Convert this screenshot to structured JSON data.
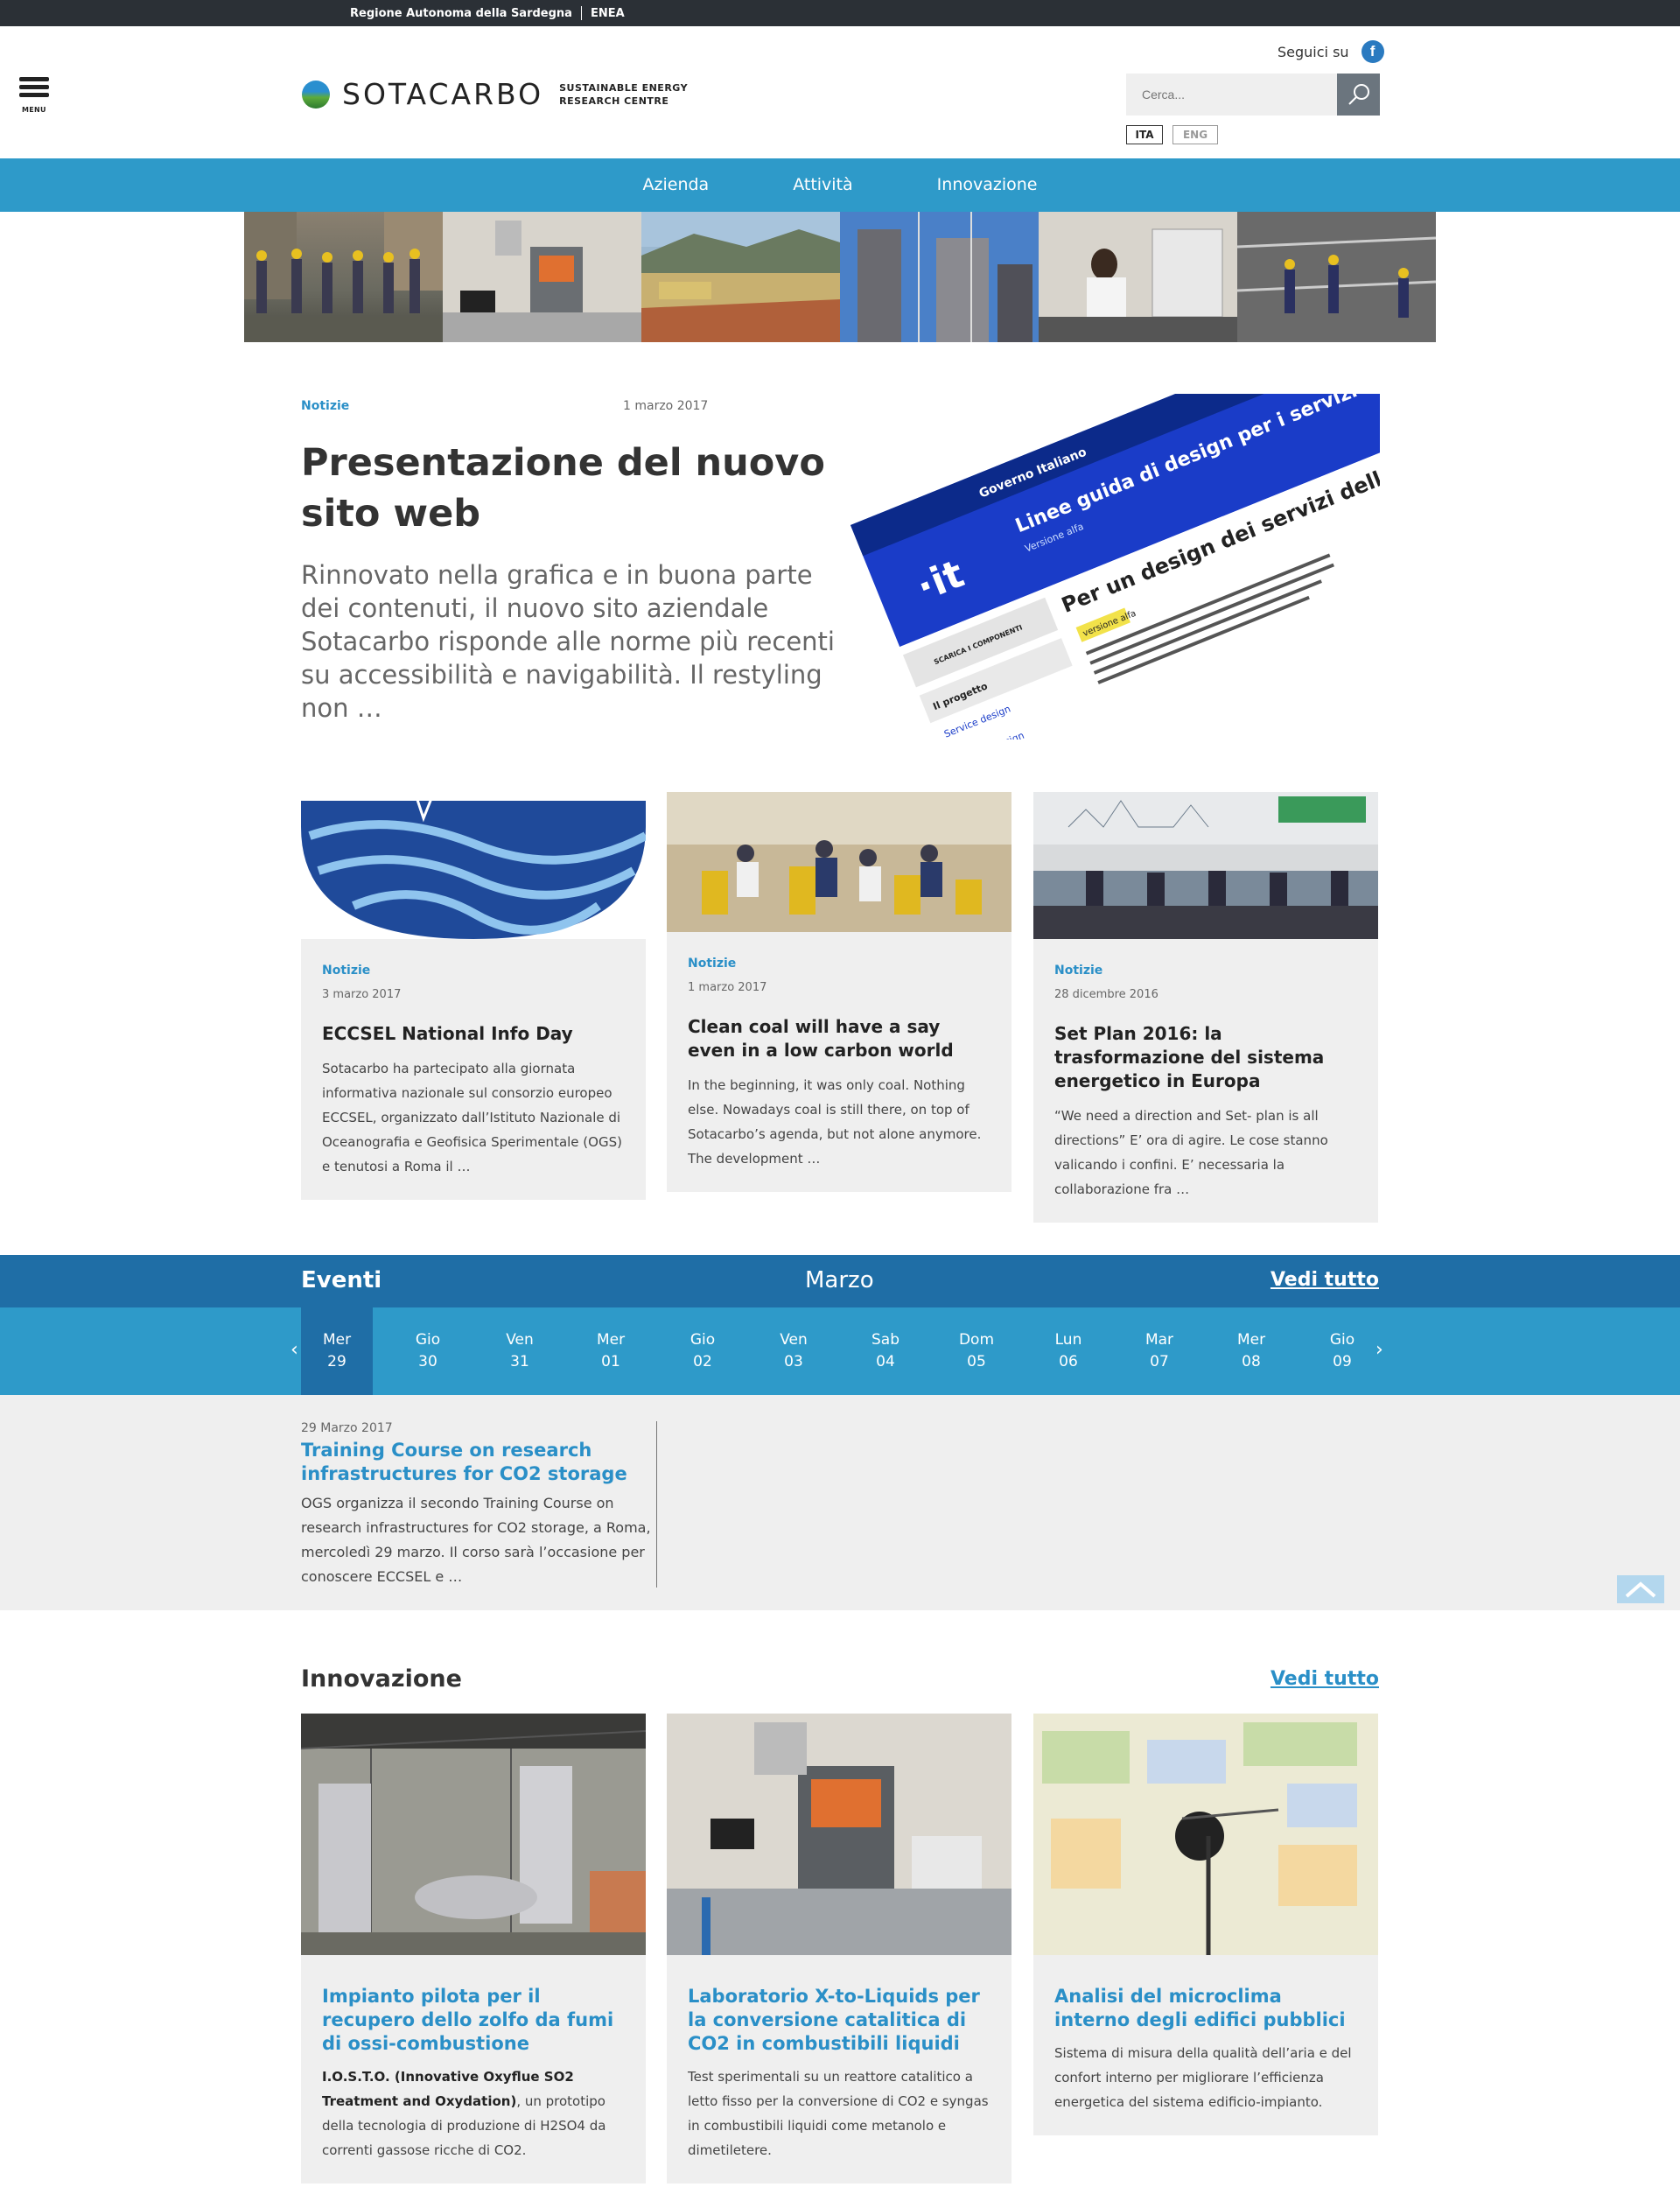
{
  "topbar": {
    "link1": "Regione Autonoma della Sardegna",
    "link2": "ENEA"
  },
  "header": {
    "menu_label": "MENU",
    "logo_word": "SOTACARBO",
    "logo_tag": "SUSTAINABLE ENERGY RESEARCH CENTRE",
    "follow_label": "Seguici su",
    "facebook_icon": "f",
    "search_placeholder": "Cerca...",
    "lang_ita": "ITA",
    "lang_eng": "ENG"
  },
  "nav": {
    "items": [
      "Azienda",
      "Attività",
      "Innovazione"
    ]
  },
  "hero": {
    "category": "Notizie",
    "date": "1 marzo 2017",
    "title": "Presentazione del nuovo sito web",
    "summary": "Rinnovato nella grafica e in buona parte dei contenuti, il nuovo sito aziendale Sotacarbo risponde alle norme più recenti su accessibilità e navigabilità. Il restyling non …",
    "image_text": {
      "gov": "Governo Italiano",
      "it": "·it",
      "guide": "Linee guida di design per i servizi web della PA",
      "version": "Versione alfa",
      "heading": "Per un design dei servizi della Pubblica Amministrazione",
      "badge": "versione alfa",
      "menu1": "SCARICA I COMPONENTI",
      "menu2": "Il progetto",
      "menu3": "Service design",
      "menu4": "Content design"
    }
  },
  "news": [
    {
      "category": "Notizie",
      "date": "3 marzo 2017",
      "title": "ECCSEL National Info Day",
      "text": "Sotacarbo ha partecipato alla giornata informativa nazionale sul consorzio europeo ECCSEL, organizzato dall’Istituto Nazionale di Oceanografia e Geofisica Sperimentale (OGS) e tenutosi a Roma il …"
    },
    {
      "category": "Notizie",
      "date": "1 marzo 2017",
      "title": "Clean coal will have a say even in a low carbon world",
      "text": "In the beginning, it was only coal. Nothing else. Nowadays coal is still there, on top of Sotacarbo’s agenda, but not alone anymore. The development …"
    },
    {
      "category": "Notizie",
      "date": "28 dicembre 2016",
      "title": "Set Plan 2016: la trasformazione del sistema energetico in Europa",
      "text": "“We need a direction and Set- plan is all directions” E’ ora di agire. Le cose stanno valicando i confini. E’ necessaria la collaborazione fra …"
    }
  ],
  "events": {
    "title": "Eventi",
    "month": "Marzo",
    "see_all": "Vedi tutto",
    "days": [
      {
        "dow": "Mer",
        "num": "29"
      },
      {
        "dow": "Gio",
        "num": "30"
      },
      {
        "dow": "Ven",
        "num": "31"
      },
      {
        "dow": "Mer",
        "num": "01"
      },
      {
        "dow": "Gio",
        "num": "02"
      },
      {
        "dow": "Ven",
        "num": "03"
      },
      {
        "dow": "Sab",
        "num": "04"
      },
      {
        "dow": "Dom",
        "num": "05"
      },
      {
        "dow": "Lun",
        "num": "06"
      },
      {
        "dow": "Mar",
        "num": "07"
      },
      {
        "dow": "Mer",
        "num": "08"
      },
      {
        "dow": "Gio",
        "num": "09"
      }
    ],
    "item": {
      "date": "29 Marzo 2017",
      "title": "Training Course on research infrastructures for CO2 storage",
      "text": "OGS organizza il secondo Training Course on research infrastructures for CO2 storage, a Roma, mercoledì 29 marzo. Il corso sarà l’occasione per conoscere ECCSEL e …"
    }
  },
  "innovation": {
    "title": "Innovazione",
    "see_all": "Vedi tutto",
    "cards": [
      {
        "title": "Impianto pilota per il recupero dello zolfo da fumi di ossi-combustione",
        "text_bold": "I.O.S.T.O. (Innovative Oxyflue SO2 Treatment and Oxydation)",
        "text": ", un prototipo della tecnologia di produzione di H2SO4 da correnti gassose ricche di CO2."
      },
      {
        "title": "Laboratorio X-to-Liquids per la conversione catalitica di CO2 in combustibili liquidi",
        "text_bold": "",
        "text": "Test sperimentali su un reattore catalitico a letto fisso per la conversione di CO2 e syngas in combustibili liquidi come metanolo e dimetiletere."
      },
      {
        "title": "Analisi del microclima interno degli edifici pubblici",
        "text_bold": "",
        "text": "Sistema di misura della qualità dell’aria e del confort interno per migliorare l’efficienza energetica del sistema edificio-impianto."
      }
    ]
  },
  "colors": {
    "brand_blue": "#2e9ac9",
    "dark_blue": "#1f6ea6",
    "link_blue": "#2a8fc7",
    "topbar": "#2b3036"
  }
}
